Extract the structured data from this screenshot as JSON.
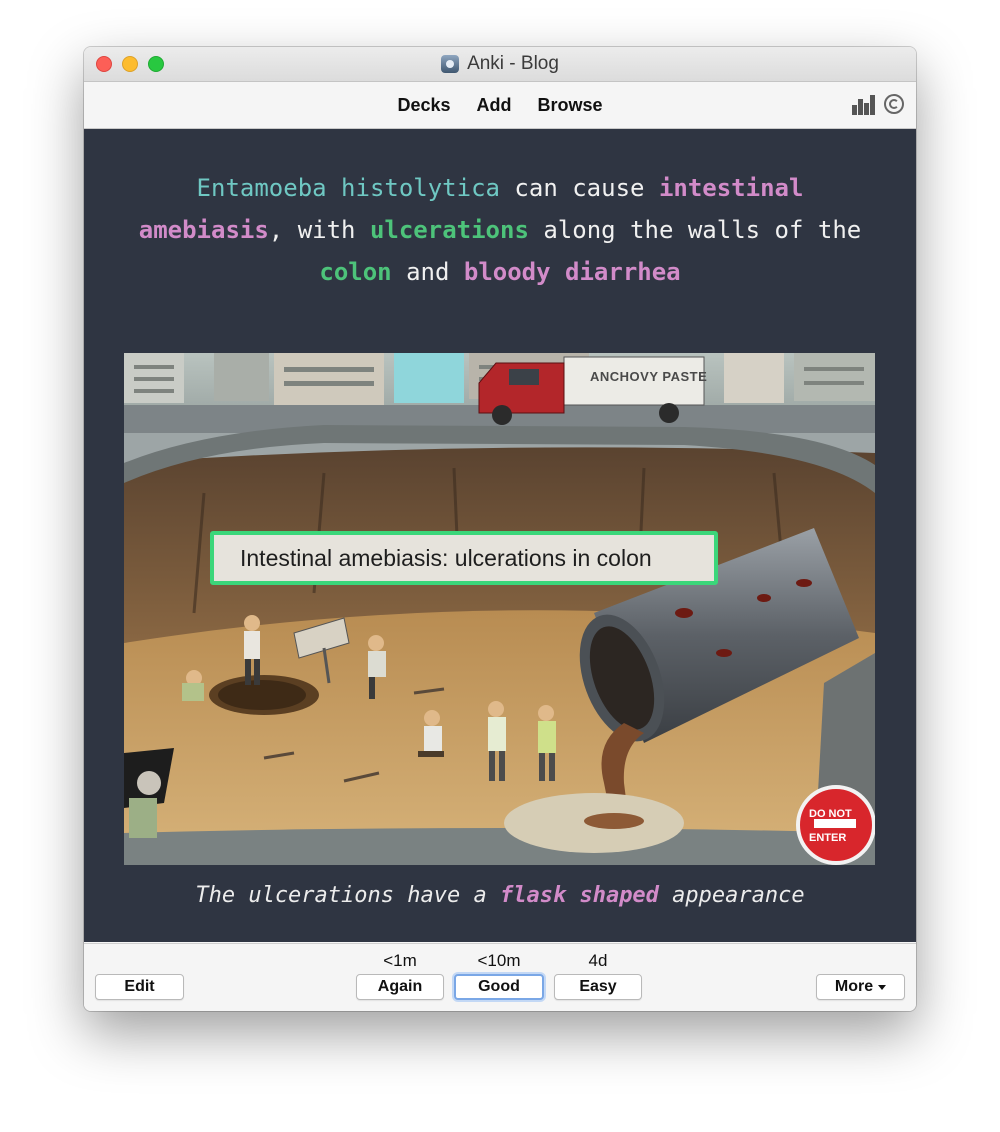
{
  "window": {
    "title": "Anki - Blog"
  },
  "toolbar": {
    "nav": [
      "Decks",
      "Add",
      "Browse"
    ],
    "icons": [
      "stats-icon",
      "sync-icon"
    ]
  },
  "card": {
    "front": {
      "segments": [
        {
          "text": "Entamoeba histolytica",
          "style": "teal"
        },
        {
          "text": " can cause ",
          "style": "plain"
        },
        {
          "text": "intestinal amebiasis",
          "style": "pink"
        },
        {
          "text": ", with ",
          "style": "plain"
        },
        {
          "text": "ulcerations",
          "style": "green"
        },
        {
          "text": " along the walls of the ",
          "style": "plain"
        },
        {
          "text": "colon",
          "style": "green"
        },
        {
          "text": " and ",
          "style": "plain"
        },
        {
          "text": "bloody diarrhea",
          "style": "pink"
        }
      ]
    },
    "image": {
      "callout": "Intestinal amebiasis: ulcerations in colon",
      "truck_sign": "ANCHOVY PASTE",
      "sign_text": [
        "DO NOT",
        "ENTER"
      ]
    },
    "back": {
      "before": "The ulcerations have a ",
      "highlight": "flask shaped",
      "after": " appearance"
    },
    "colors": {
      "background": "#2f3542",
      "teal": "#6fc8c3",
      "pink": "#d28bc9",
      "green": "#4dc37a",
      "callout_border": "#3bd67a"
    }
  },
  "bottom": {
    "edit_label": "Edit",
    "answers": [
      {
        "interval": "<1m",
        "label": "Again"
      },
      {
        "interval": "<10m",
        "label": "Good"
      },
      {
        "interval": "4d",
        "label": "Easy"
      }
    ],
    "more_label": "More"
  }
}
